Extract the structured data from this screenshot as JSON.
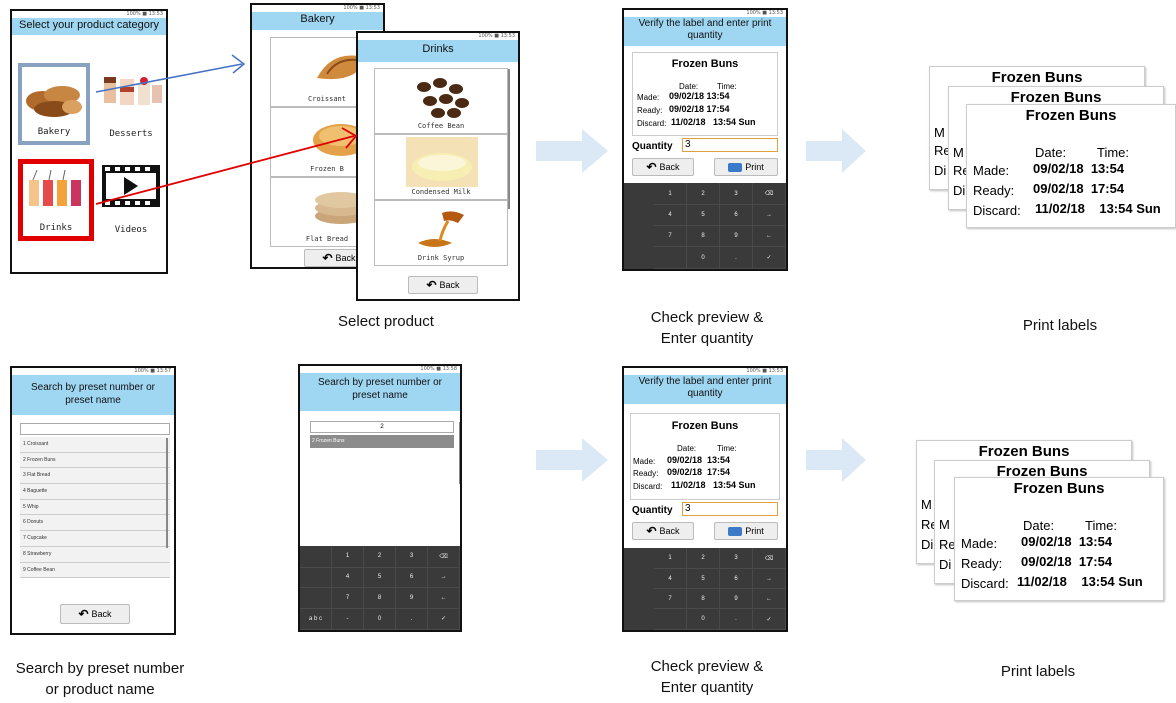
{
  "captions": {
    "select_product": "Select product",
    "check_preview_1a": "Check preview &",
    "check_preview_1b": "Enter quantity",
    "print_labels_1": "Print labels",
    "search_a": "Search by preset number",
    "search_b": "or product name",
    "check_preview_2a": "Check preview &",
    "check_preview_2b": "Enter quantity",
    "print_labels_2": "Print labels"
  },
  "category_screen": {
    "header": "Select your product category",
    "tiles": [
      "Bakery",
      "Desserts",
      "Drinks",
      "Videos"
    ]
  },
  "bakery_screen": {
    "header": "Bakery",
    "items": [
      "Croissant",
      "Frozen B",
      "Flat Bread"
    ],
    "back": "Back"
  },
  "drinks_screen": {
    "header": "Drinks",
    "items": [
      "Coffee Bean",
      "Condensed Milk",
      "Drink Syrup"
    ],
    "back": "Back"
  },
  "verify_screen": {
    "header_line1": "Verify the label and enter print",
    "header_line2": "quantity",
    "product": "Frozen Buns",
    "date_label": "Date:",
    "time_label": "Time:",
    "made_label": "Made:",
    "made_value": "09/02/18  13:54",
    "ready_label": "Ready:",
    "ready_value": "09/02/18  17:54",
    "discard_label": "Discard:",
    "discard_value": "11/02/18   13:54 Sun",
    "quantity_label": "Quantity",
    "quantity_value": "3",
    "back": "Back",
    "print": "Print",
    "keys": [
      "1",
      "2",
      "3",
      "⌫",
      "4",
      "5",
      "6",
      "→",
      "7",
      "8",
      "9",
      "←",
      "",
      "0",
      ".",
      "✓"
    ]
  },
  "search_screen": {
    "header_line1": "Search by preset number or",
    "header_line2": "preset name",
    "items": [
      "1 Croissant",
      "2 Frozen Buns",
      "3 Flat Bread",
      "4 Baguette",
      "5 Whip",
      "6 Donuts",
      "7 Cupcake",
      "8 Strawberry",
      "9 Coffee Bean"
    ],
    "back": "Back"
  },
  "search_typed_screen": {
    "header_line1": "Search by preset number or",
    "header_line2": "preset name",
    "query": "2",
    "result": "2 Frozen Buns",
    "keys": [
      "",
      "1",
      "2",
      "3",
      "⌫",
      "",
      "4",
      "5",
      "6",
      "→",
      "",
      "7",
      "8",
      "9",
      "←",
      "a b c",
      "-",
      "0",
      ".",
      "✓"
    ]
  },
  "labels": {
    "title": "Frozen Buns",
    "date_label": "Date:",
    "time_label": "Time:",
    "made_label": "Made:",
    "made_value": "09/02/18  13:54",
    "ready_label": "Ready:",
    "ready_value": "09/02/18  17:54",
    "discard_label": "Discard:",
    "discard_value": "11/02/18    13:54 Sun",
    "peek_m": "M",
    "peek_re": "Re",
    "peek_di": "Di"
  },
  "colors": {
    "header": "#9fd6f2",
    "bakery_highlight": "#8aa2c1",
    "drinks_highlight": "#e00000",
    "blue_arrow": "#4472c4",
    "red_arrow": "#e00000",
    "flow_arrow": "#dbe9f6"
  }
}
